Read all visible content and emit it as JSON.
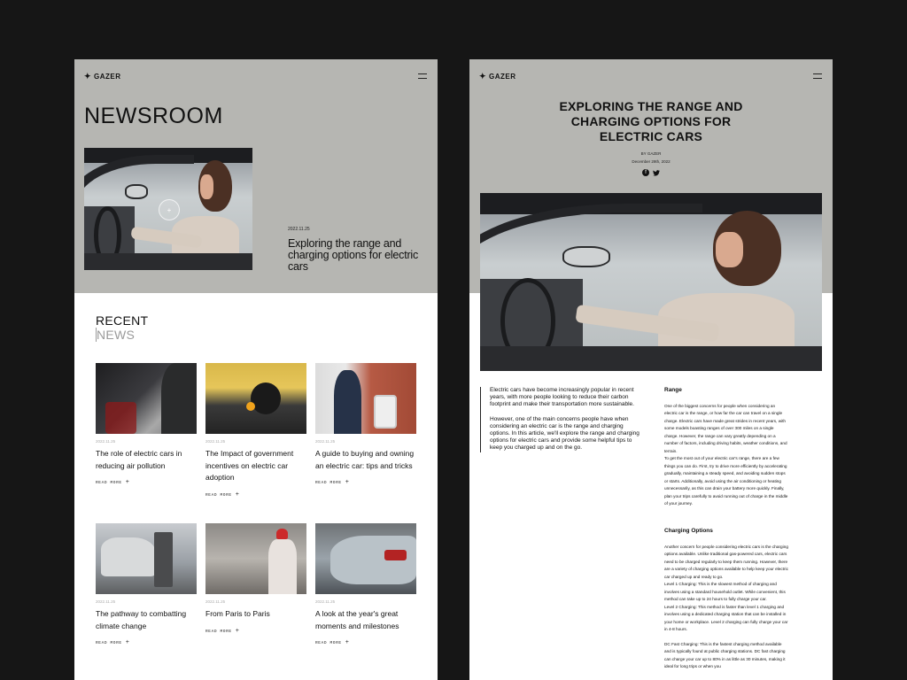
{
  "brand": {
    "name": "GAZER",
    "star": "✦"
  },
  "newsroom": {
    "title": "NEWSROOM",
    "hero": {
      "date": "2022.11.25",
      "headline": "Exploring the range and charging options for electric cars",
      "play_symbol": "+"
    },
    "recent_line1": "RECENT",
    "recent_line2": "NEWS",
    "read_more": "READ MORE",
    "plus": "+",
    "articles": [
      {
        "date": "2022.11.25",
        "title": "The role of electric cars in reducing air pollution"
      },
      {
        "date": "2022.11.25",
        "title": "The Impact of government incentives on electric car adoption"
      },
      {
        "date": "2022.11.25",
        "title": "A guide to buying and owning an electric car: tips and tricks"
      },
      {
        "date": "2022.11.25",
        "title": "The pathway to combatting climate change"
      },
      {
        "date": "2022.11.25",
        "title": "From Paris to Paris"
      },
      {
        "date": "2022.11.25",
        "title": "A look at the year's great moments and milestones"
      }
    ]
  },
  "article": {
    "title": "EXPLORING THE RANGE AND CHARGING OPTIONS FOR ELECTRIC CARS",
    "byline": "BY GAZER",
    "date": "December 29th, 2022",
    "facebook": "f",
    "twitter": "🐦",
    "lead_p1": "Electric cars have become increasingly popular in recent years, with more people looking to reduce their carbon footprint and make their transportation more sustainable.",
    "lead_p2": "However, one of the main concerns people have when considering an electric car is the range and charging options. In this article, we'll explore the range and charging options for electric cars and provide some helpful tips to keep you charged up and on the go.",
    "range_heading": "Range",
    "range_p1": "One of the biggest concerns for people when considering an electric car is the range, or how far the car can travel on a single charge. Electric cars have made great strides in recent years, with some models boasting ranges of over 300 miles on a single charge. However, the range can vary greatly depending on a number of factors, including driving habits, weather conditions, and terrain.",
    "range_p2": "To get the most out of your electric car's range, there are a few things you can do. First, try to drive more efficiently by accelerating gradually, maintaining a steady speed, and avoiding sudden stops or starts. Additionally, avoid using the air conditioning or heating unnecessarily, as this can drain your battery more quickly. Finally, plan your trips carefully to avoid running out of charge in the middle of your journey.",
    "charging_heading": "Charging Options",
    "charging_p1": "Another concern for people considering electric cars is the charging options available. Unlike traditional gas-powered cars, electric cars need to be charged regularly to keep them running. However, there are a variety of charging options available to help keep your electric car charged up and ready to go.",
    "charging_p2": "Level 1 Charging: This is the slowest method of charging and involves using a standard household outlet. While convenient, this method can take up to 24 hours to fully charge your car.",
    "charging_p3": "Level 2 Charging: This method is faster than level 1 charging and involves using a dedicated charging station that can be installed in your home or workplace. Level 2 charging can fully charge your car in 4-8 hours.",
    "charging_p4": "DC Fast Charging: This is the fastest charging method available and is typically found at public charging stations. DC fast charging can charge your car up to 80% in as little as 30 minutes, making it ideal for long trips or when you"
  }
}
